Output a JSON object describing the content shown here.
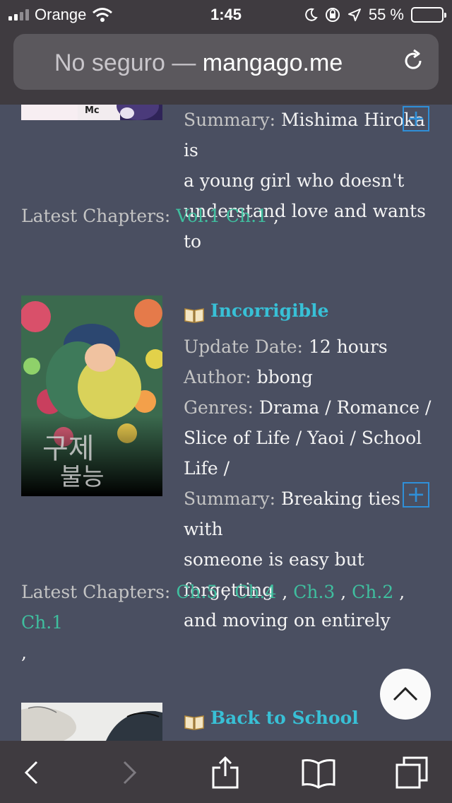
{
  "status": {
    "carrier": "Orange",
    "time": "1:45",
    "battery_percent": "55 %"
  },
  "address": {
    "insecure_label": "No seguro",
    "dash": " — ",
    "host": "mangago.me"
  },
  "entries": [
    {
      "summary_label": "Summary: ",
      "summary_line1": "Mishima Hiroka is",
      "summary_line2": "a young girl who doesn't",
      "summary_line3": "understand love and wants to",
      "latest_label": "Latest Chapters: ",
      "chapters": [
        "Vol.1 Ch.1"
      ],
      "trailing_sep": ","
    },
    {
      "title": "Incorrigible",
      "update_label": "Update Date: ",
      "update_value": "12 hours",
      "author_label": "Author: ",
      "author_value": "bbong",
      "genres_label": "Genres: ",
      "genres_line1": "Drama / Romance /",
      "genres_line2": "Slice of Life / Yaoi / School",
      "genres_line3": "Life /",
      "summary_label": "Summary: ",
      "summary_line1": "Breaking ties with",
      "summary_line2": "someone is easy but forgetting",
      "summary_line3": "and moving on entirely",
      "latest_label": "Latest Chapters: ",
      "chapters": [
        "Ch.5",
        "Ch.4",
        "Ch.3",
        "Ch.2",
        "Ch.1"
      ],
      "separator": ",",
      "trailing_sep": ","
    },
    {
      "title": "Back to School"
    }
  ],
  "icons": {
    "plus": "+",
    "book": "book-icon",
    "scroll_top": "chevron-up-icon"
  },
  "colors": {
    "background": "#4a4f61",
    "link": "#38c0d6",
    "chapter": "#3fbf9f",
    "battery": "#ffd60a"
  }
}
